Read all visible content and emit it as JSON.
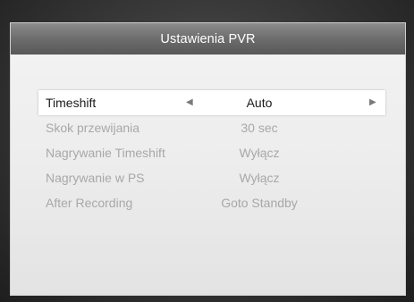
{
  "window": {
    "title": "Ustawienia PVR"
  },
  "settings": [
    {
      "label": "Timeshift",
      "value": "Auto",
      "selected": true
    },
    {
      "label": "Skok przewijania",
      "value": "30 sec",
      "selected": false
    },
    {
      "label": "Nagrywanie Timeshift",
      "value": "Wyłącz",
      "selected": false
    },
    {
      "label": "Nagrywanie w PS",
      "value": "Wyłącz",
      "selected": false
    },
    {
      "label": "After Recording",
      "value": "Goto Standby",
      "selected": false
    }
  ],
  "icons": {
    "left_arrow": "left-triangle",
    "right_arrow": "right-triangle"
  },
  "colors": {
    "header": "#6f6f6f",
    "panel": "#ededed",
    "selected_row": "#ffffff",
    "inactive_text": "#a8a8a8",
    "active_text": "#1a1a1a"
  }
}
